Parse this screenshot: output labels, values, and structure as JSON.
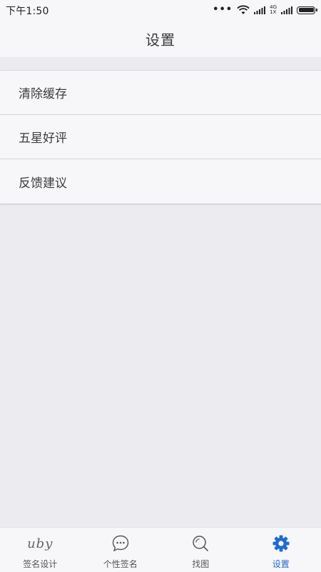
{
  "status_bar": {
    "time": "下午1:50",
    "network_top": "4G",
    "network_bottom": "1X"
  },
  "header": {
    "title": "设置"
  },
  "settings": {
    "items": [
      {
        "label": "清除缓存"
      },
      {
        "label": "五星好评"
      },
      {
        "label": "反馈建议"
      }
    ]
  },
  "tabs": [
    {
      "label": "签名设计",
      "icon": "signature-icon",
      "active": false
    },
    {
      "label": "个性签名",
      "icon": "chat-bubble-icon",
      "active": false
    },
    {
      "label": "找图",
      "icon": "search-icon",
      "active": false
    },
    {
      "label": "设置",
      "icon": "gear-icon",
      "active": true
    }
  ],
  "signature_glyph_text": "uby",
  "colors": {
    "accent": "#1E6BD0",
    "background": "#ECECF0",
    "surface": "#F7F6F9",
    "divider": "#D5D5DA"
  }
}
